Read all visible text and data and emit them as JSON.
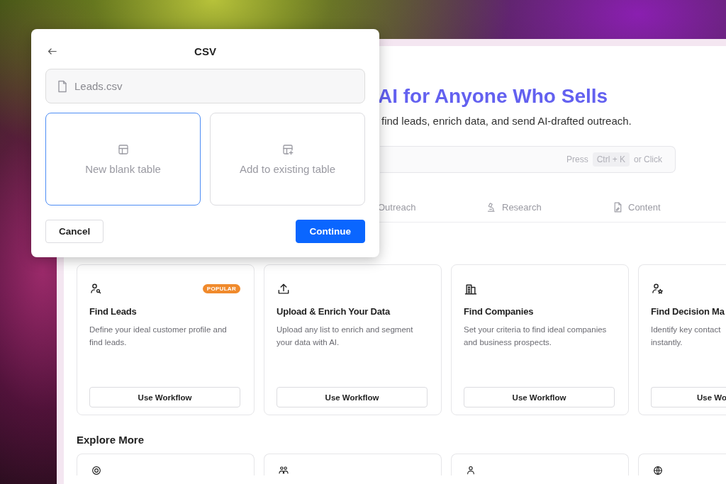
{
  "hero": {
    "heading": "AI for Anyone Who Sells",
    "subtitle": "find leads, enrich data, and send AI-drafted outreach.",
    "search": {
      "hint_prefix": "Press",
      "shortcut": "Ctrl + K",
      "hint_suffix": "or Click"
    }
  },
  "tabs": [
    {
      "kind": "label",
      "label": "Outreach"
    },
    {
      "kind": "research",
      "label": "Research"
    },
    {
      "kind": "content",
      "label": "Content"
    }
  ],
  "workflows": [
    {
      "kind": "leads",
      "title": "Find Leads",
      "description": "Define your ideal customer profile and find leads.",
      "badge": "POPULAR",
      "button": "Use Workflow"
    },
    {
      "kind": "upload",
      "title": "Upload & Enrich Your Data",
      "description": "Upload any list to enrich and segment your data with AI.",
      "button": "Use Workflow"
    },
    {
      "kind": "companies",
      "title": "Find Companies",
      "description": "Set your criteria to find ideal companies and business prospects.",
      "button": "Use Workflow"
    },
    {
      "kind": "decision",
      "title": "Find Decision Ma",
      "description": "Identify key contact\ninstantly.",
      "button": "Use Wo"
    }
  ],
  "explore_more": {
    "title": "Explore More",
    "cards": [
      {
        "kind": "location"
      },
      {
        "kind": "team"
      },
      {
        "kind": "contact"
      },
      {
        "kind": "web"
      }
    ]
  },
  "modal": {
    "title": "CSV",
    "file_field": {
      "value": "Leads.csv"
    },
    "options": [
      {
        "kind": "blank",
        "label": "New blank table",
        "selected": true
      },
      {
        "kind": "existing",
        "label": "Add to existing table",
        "selected": false
      }
    ],
    "buttons": [
      {
        "label": "Cancel",
        "kind": "secondary"
      },
      {
        "label": "Continue",
        "kind": "primary"
      }
    ]
  }
}
